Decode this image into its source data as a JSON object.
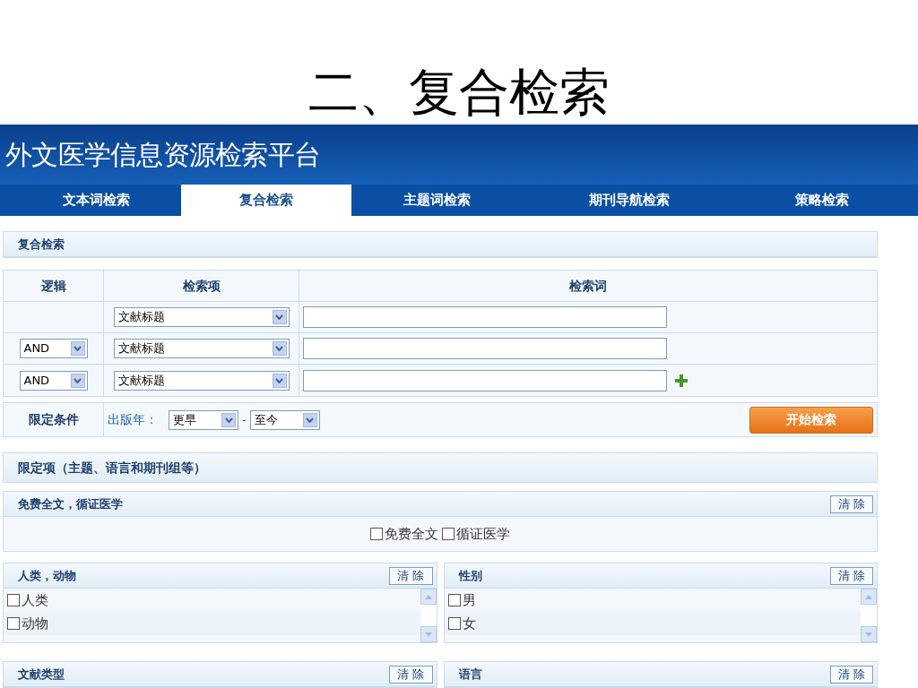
{
  "slide_title": "二、复合检索",
  "site_title": "外文医学信息资源检索平台",
  "tabs": [
    {
      "label": "文本词检索",
      "selected": false
    },
    {
      "label": "复合检索",
      "selected": true
    },
    {
      "label": "主题词检索",
      "selected": false
    },
    {
      "label": "期刊导航检索",
      "selected": false
    },
    {
      "label": "策略检索",
      "selected": false
    }
  ],
  "section_title": "复合检索",
  "search_table": {
    "columns": [
      "逻辑",
      "检索项",
      "检索词"
    ],
    "rows": [
      {
        "field": "文献标题",
        "add_button": false
      },
      {
        "operator": "AND",
        "field": "文献标题",
        "add_button": false
      },
      {
        "operator": "AND",
        "field": "文献标题",
        "add_button": true
      }
    ]
  },
  "limits": {
    "label": "限定条件",
    "year_label": "出版年：",
    "from": "更早",
    "separator": "-",
    "to": "至今"
  },
  "search_button": "开始检索",
  "filters_title": "限定项（主题、语言和期刊组等）",
  "free_panel": {
    "title": "免费全文，循证医学",
    "clear": "清 除",
    "options": [
      {
        "label": "免费全文",
        "checked": false
      },
      {
        "label": "循证医学",
        "checked": false
      }
    ]
  },
  "panels": [
    {
      "title": "人类，动物",
      "clear": "清 除",
      "options": [
        {
          "label": "人类",
          "checked": false
        },
        {
          "label": "动物",
          "checked": false
        }
      ]
    },
    {
      "title": "性别",
      "clear": "清 除",
      "options": [
        {
          "label": "男",
          "checked": false
        },
        {
          "label": "女",
          "checked": false
        }
      ]
    },
    {
      "title": "文献类型",
      "clear": "清 除"
    },
    {
      "title": "语言",
      "clear": "清 除"
    }
  ]
}
